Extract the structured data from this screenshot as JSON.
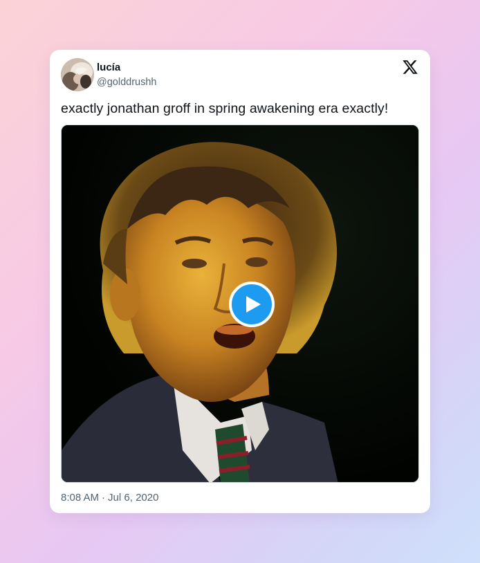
{
  "tweet": {
    "author": {
      "display_name": "lucía",
      "handle": "@golddrushh"
    },
    "text": "exactly jonathan groff in spring awakening era exactly!",
    "time": "8:08 AM",
    "separator": "·",
    "date": "Jul 6, 2020",
    "media": {
      "type": "video",
      "play_icon": "play-icon"
    }
  },
  "colors": {
    "accent": "#1d9bf0",
    "text": "#0f1419",
    "muted": "#536471"
  },
  "icons": {
    "logo": "x-logo-icon",
    "play": "play-icon"
  }
}
